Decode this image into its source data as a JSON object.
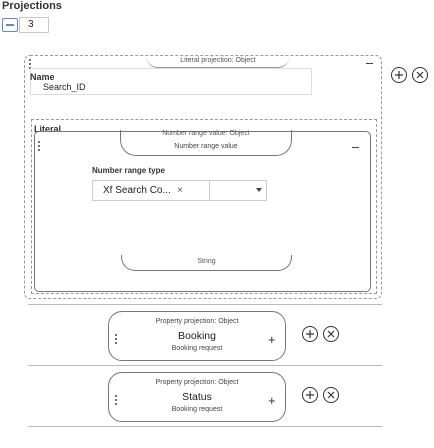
{
  "header": {
    "title": "Projections",
    "count": "3"
  },
  "literal_projection": {
    "caption": "Literal projection: Object",
    "name_label": "Name",
    "name_value": "Search_ID",
    "literal_label": "Literal",
    "number_range": {
      "caption": "Number range value: Object",
      "title": "Number range value",
      "type_label": "Number range type",
      "type_value": "Xf Search Co...",
      "clear": "×",
      "footer": "String"
    }
  },
  "property_projections": [
    {
      "caption": "Property projection: Object",
      "title": "Booking",
      "subtitle": "Booking request",
      "add": "+"
    },
    {
      "caption": "Property projection: Object",
      "title": "Status",
      "subtitle": "Booking request",
      "add": "+"
    }
  ],
  "icons": {
    "add_circle": "add-circle-icon",
    "navigate_circle": "navigate-circle-icon",
    "drag": "drag-handle-icon",
    "collapse": "collapse-icon",
    "dropdown": "chevron-down-icon"
  }
}
